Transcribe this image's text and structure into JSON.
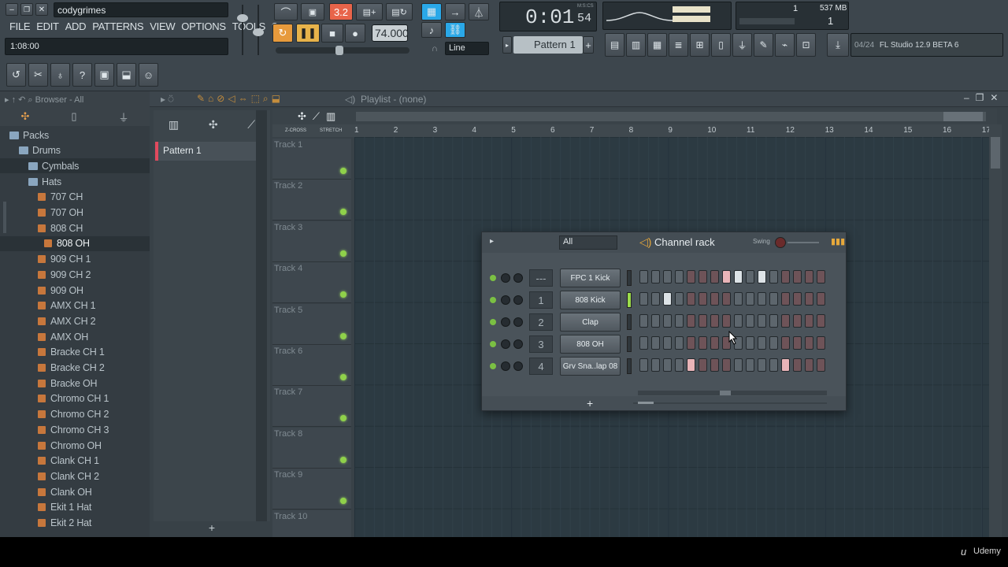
{
  "window": {
    "project_name": "codygrimes"
  },
  "menu": [
    "FILE",
    "EDIT",
    "ADD",
    "PATTERNS",
    "VIEW",
    "OPTIONS",
    "TOOLS",
    "?"
  ],
  "hint_bar": {
    "time": "1:08:00"
  },
  "transport": {
    "tempo": "74.000",
    "time_main": "0:01",
    "time_sub": "54",
    "time_label": "M:S:CS",
    "snap": "Line",
    "pattern_select": "Pattern 1"
  },
  "perf": {
    "cpu": "1",
    "memory": "537 MB",
    "poly": "1"
  },
  "news": {
    "counter": "04/24",
    "text": "FL Studio 12.9 BETA 6"
  },
  "browser": {
    "title": "Browser - All",
    "items": [
      {
        "label": "Packs",
        "type": "folder",
        "level": 0
      },
      {
        "label": "Drums",
        "type": "folder",
        "level": 1
      },
      {
        "label": "Cymbals",
        "type": "folder",
        "level": 2
      },
      {
        "label": "Hats",
        "type": "folder",
        "level": 2
      },
      {
        "label": "707 CH",
        "type": "sample",
        "level": 3
      },
      {
        "label": "707 OH",
        "type": "sample",
        "level": 3
      },
      {
        "label": "808 CH",
        "type": "sample",
        "level": 3
      },
      {
        "label": "808 OH",
        "type": "sample",
        "level": 3,
        "selected": true
      },
      {
        "label": "909 CH 1",
        "type": "sample",
        "level": 3
      },
      {
        "label": "909 CH 2",
        "type": "sample",
        "level": 3
      },
      {
        "label": "909 OH",
        "type": "sample",
        "level": 3
      },
      {
        "label": "AMX CH 1",
        "type": "sample",
        "level": 3
      },
      {
        "label": "AMX CH 2",
        "type": "sample",
        "level": 3
      },
      {
        "label": "AMX OH",
        "type": "sample",
        "level": 3
      },
      {
        "label": "Bracke CH 1",
        "type": "sample",
        "level": 3
      },
      {
        "label": "Bracke CH 2",
        "type": "sample",
        "level": 3
      },
      {
        "label": "Bracke OH",
        "type": "sample",
        "level": 3
      },
      {
        "label": "Chromo CH 1",
        "type": "sample",
        "level": 3
      },
      {
        "label": "Chromo CH 2",
        "type": "sample",
        "level": 3
      },
      {
        "label": "Chromo CH 3",
        "type": "sample",
        "level": 3
      },
      {
        "label": "Chromo OH",
        "type": "sample",
        "level": 3
      },
      {
        "label": "Clank CH 1",
        "type": "sample",
        "level": 3
      },
      {
        "label": "Clank CH 2",
        "type": "sample",
        "level": 3
      },
      {
        "label": "Clank OH",
        "type": "sample",
        "level": 3
      },
      {
        "label": "Ekit 1 Hat",
        "type": "sample",
        "level": 3
      },
      {
        "label": "Ekit 2 Hat",
        "type": "sample",
        "level": 3
      }
    ]
  },
  "playlist": {
    "title": "Playlist - (none)",
    "pattern_item": "Pattern 1",
    "tracks": [
      "Track 1",
      "Track 2",
      "Track 3",
      "Track 4",
      "Track 5",
      "Track 6",
      "Track 7",
      "Track 8",
      "Track 9",
      "Track 10"
    ],
    "bars": [
      "1",
      "2",
      "3",
      "4",
      "5",
      "6",
      "7",
      "8",
      "9",
      "10",
      "11",
      "12",
      "13",
      "14",
      "15",
      "16",
      "17"
    ],
    "crossfade_label": "Z-CROSS",
    "stretch_label": "STRETCH"
  },
  "channel_rack": {
    "title": "Channel rack",
    "filter": "All",
    "swing_label": "Swing",
    "channels": [
      {
        "number": "---",
        "name": "FPC 1 Kick",
        "steps": [
          0,
          0,
          0,
          0,
          0,
          0,
          0,
          1,
          1,
          0,
          1,
          0,
          0,
          0,
          0,
          0
        ]
      },
      {
        "number": "1",
        "name": "808 Kick",
        "steps": [
          0,
          0,
          1,
          0,
          0,
          0,
          0,
          0,
          0,
          0,
          0,
          0,
          0,
          0,
          0,
          0
        ]
      },
      {
        "number": "2",
        "name": "Clap",
        "steps": [
          0,
          0,
          0,
          0,
          0,
          0,
          0,
          0,
          0,
          0,
          0,
          0,
          0,
          0,
          0,
          0
        ]
      },
      {
        "number": "3",
        "name": "808 OH",
        "steps": [
          0,
          0,
          0,
          0,
          0,
          0,
          0,
          0,
          0,
          0,
          0,
          0,
          0,
          0,
          0,
          0
        ]
      },
      {
        "number": "4",
        "name": "Grv Sna..lap 08",
        "steps": [
          0,
          0,
          0,
          0,
          1,
          0,
          0,
          0,
          0,
          0,
          0,
          0,
          1,
          0,
          0,
          0
        ]
      }
    ],
    "add_label": "+"
  },
  "watermark": "Udemy"
}
